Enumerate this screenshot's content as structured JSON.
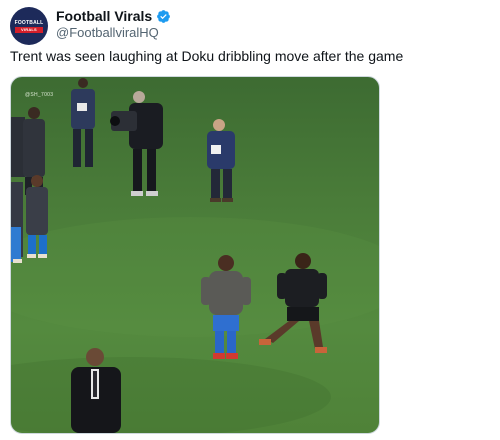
{
  "account": {
    "display_name": "Football Virals",
    "handle": "@FootballviralHQ",
    "verified": true,
    "avatar_text": "FOOTBALL",
    "avatar_subtext": "VIRALS"
  },
  "tweet": {
    "text": "Trent was seen laughing at Doku dribbling move after the game"
  },
  "media": {
    "type": "video-frame",
    "watermark": "@SH_7003"
  },
  "colors": {
    "verified_badge": "#1d9bf0",
    "pitch": "#4a7c39",
    "text_primary": "#0f1419",
    "text_secondary": "#536471"
  },
  "icons": [
    "verified-badge-icon"
  ]
}
